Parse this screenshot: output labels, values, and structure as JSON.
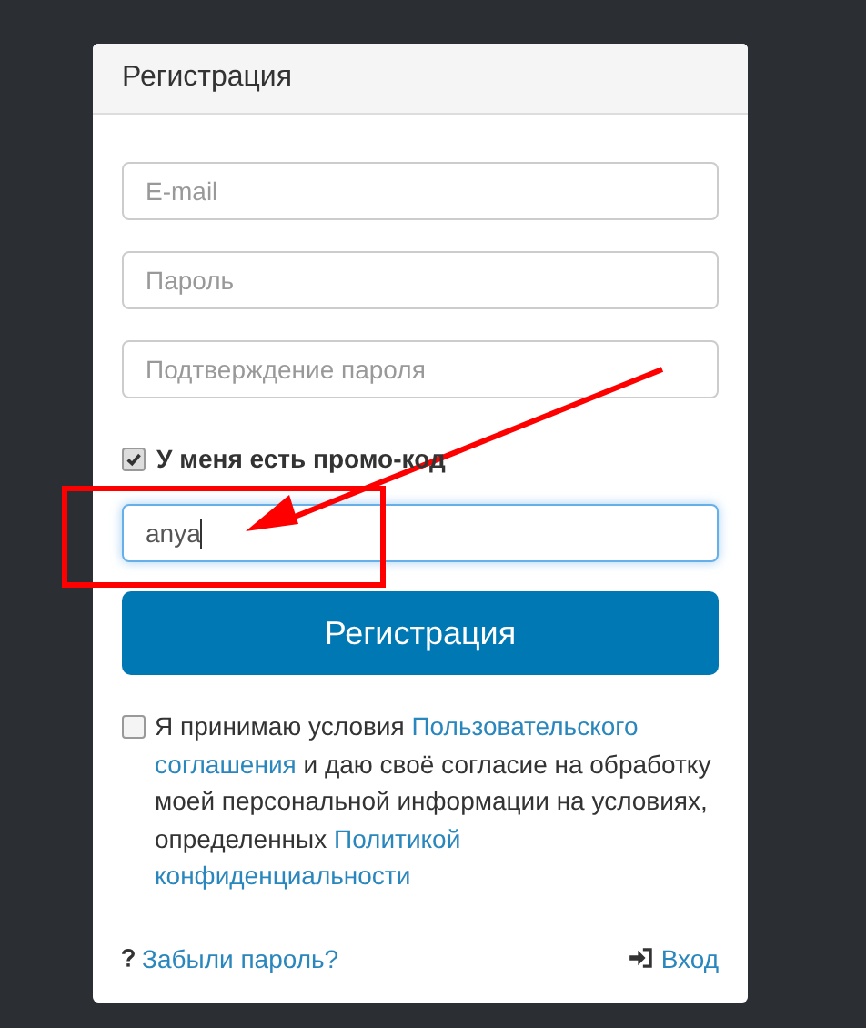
{
  "panel": {
    "title": "Регистрация"
  },
  "fields": [
    {
      "placeholder": "E-mail"
    },
    {
      "placeholder": "Пароль"
    },
    {
      "placeholder": "Подтверждение пароля"
    }
  ],
  "promo": {
    "label": "У меня есть промо-код",
    "checked": true,
    "value": "anya",
    "focused": true
  },
  "submit": "Регистрация",
  "terms": {
    "checked": false,
    "parts": [
      {
        "kind": "text",
        "text": "Я принимаю условия"
      },
      {
        "kind": "link",
        "text": "Пользовательского"
      },
      {
        "kind": "link",
        "text": "соглашения"
      },
      {
        "kind": "text",
        "text": "и даю своё согласие на обработку моей персональной информации на условиях, определенных"
      },
      {
        "kind": "link",
        "text": "Политикой"
      },
      {
        "kind": "link",
        "text": "конфиденциальности"
      }
    ]
  },
  "footer": {
    "forgot": "Забыли пароль?",
    "login": "Вход"
  },
  "annotations": {
    "frame": true,
    "arrow": true
  }
}
